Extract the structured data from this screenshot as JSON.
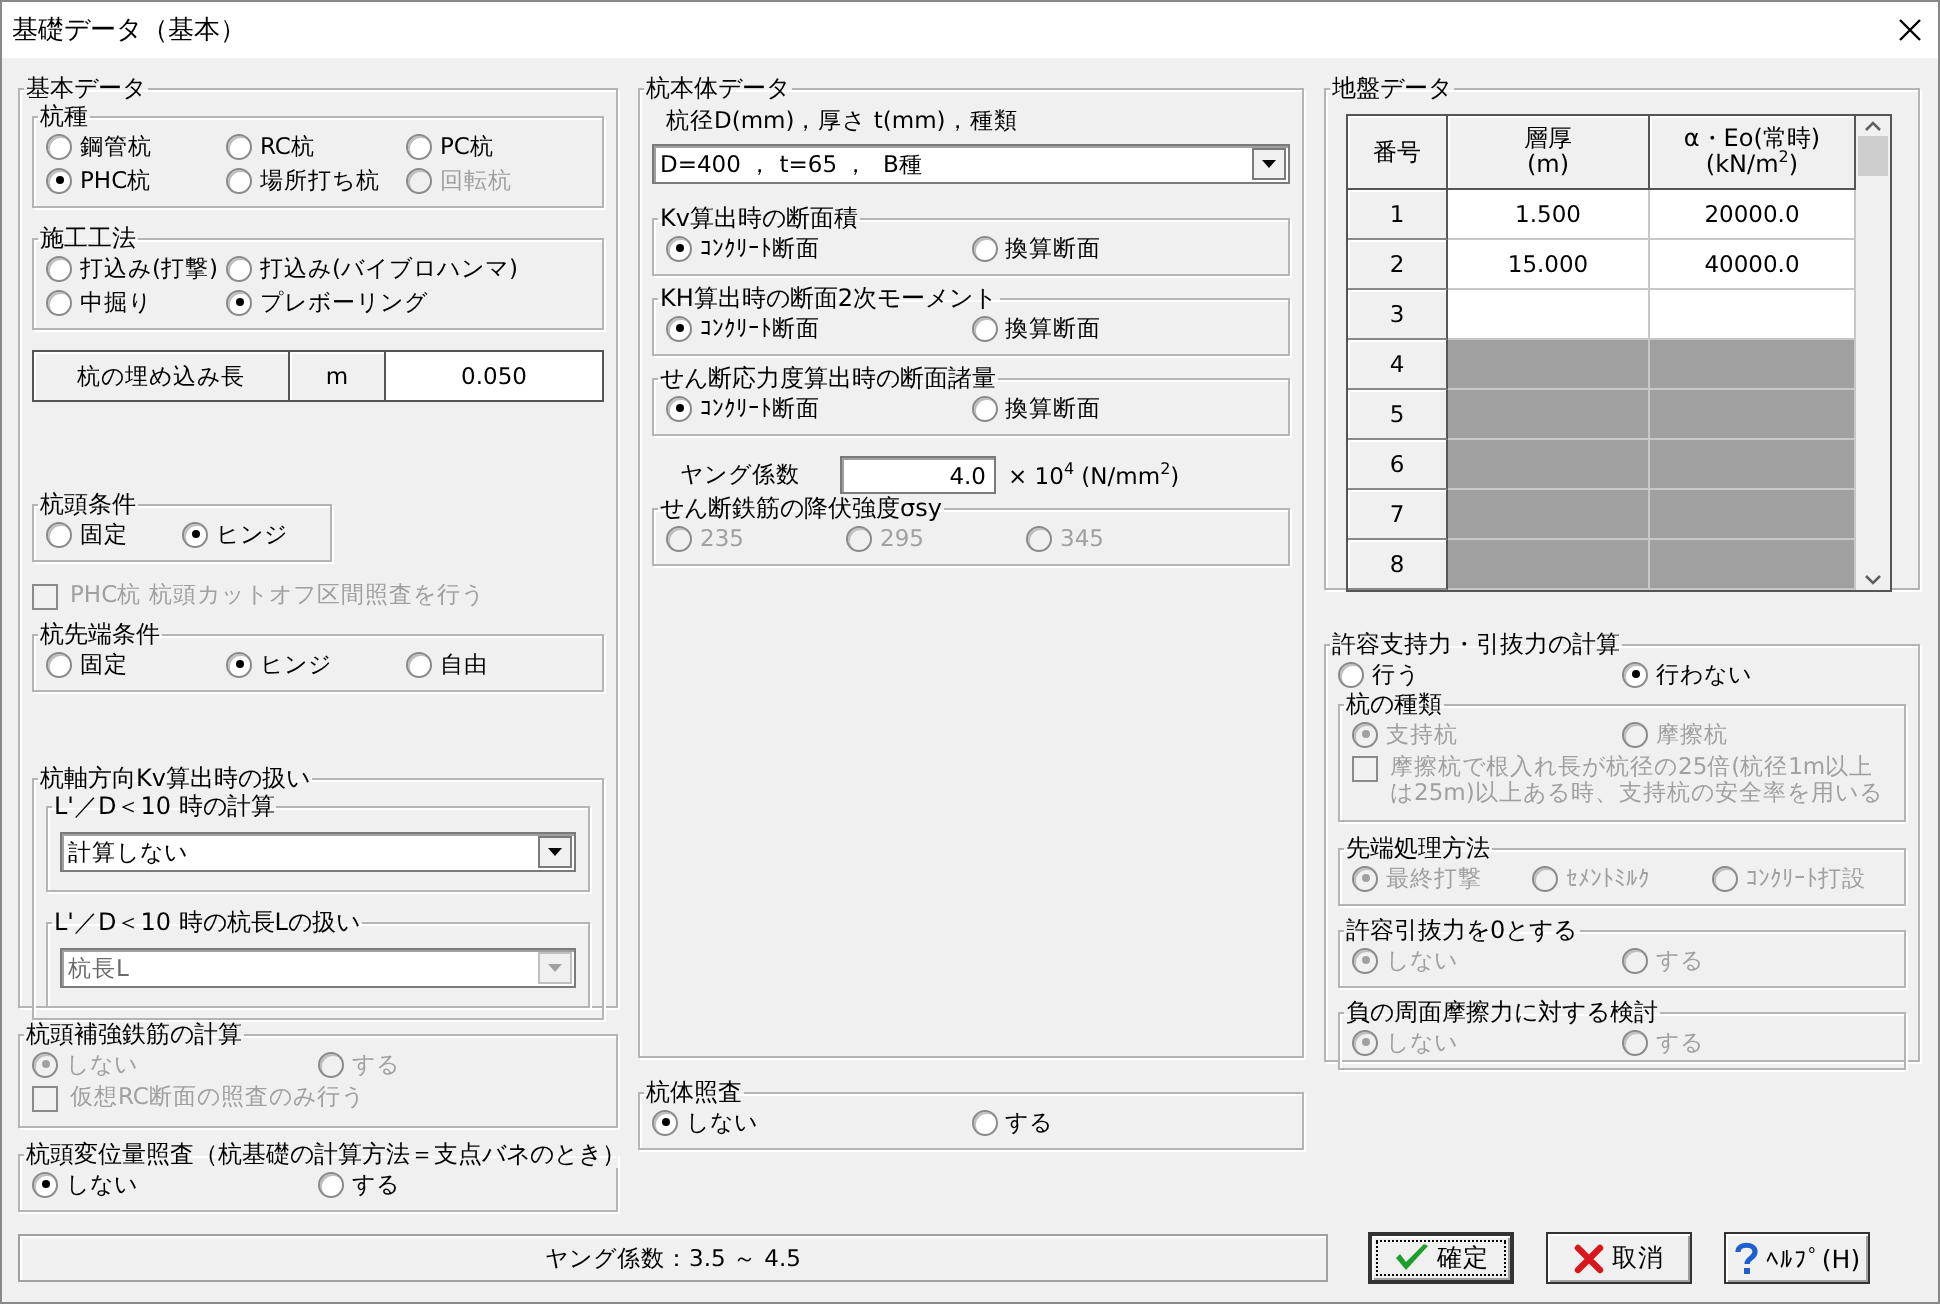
{
  "window": {
    "title": "基礎データ（基本）"
  },
  "columns": [
    {
      "blocks": [
        {
          "kind": "group",
          "title": "基本データ",
          "children": [
            {
              "kind": "group",
              "title": "杭種",
              "options": [
                {
                  "label": "鋼管杭",
                  "selected": false,
                  "disabled": false
                },
                {
                  "label": "RC杭",
                  "selected": false,
                  "disabled": false
                },
                {
                  "label": "PC杭",
                  "selected": false,
                  "disabled": false
                },
                {
                  "label": "PHC杭",
                  "selected": true,
                  "disabled": false
                },
                {
                  "label": "場所打ち杭",
                  "selected": false,
                  "disabled": false
                },
                {
                  "label": "回転杭",
                  "selected": false,
                  "disabled": true
                }
              ]
            },
            {
              "kind": "group",
              "title": "施工工法",
              "options": [
                {
                  "label": "打込み(打撃)",
                  "selected": false,
                  "disabled": false
                },
                {
                  "label": "打込み(バイブロハンマ)",
                  "selected": false,
                  "disabled": false
                },
                {
                  "label": "中掘り",
                  "selected": false,
                  "disabled": false
                },
                {
                  "label": "プレボーリング",
                  "selected": true,
                  "disabled": false
                }
              ]
            },
            {
              "kind": "value_row",
              "label": "杭の埋め込み長",
              "unit": "m",
              "value": "0.050"
            },
            {
              "kind": "group",
              "title": "杭頭条件",
              "options": [
                {
                  "label": "固定",
                  "selected": false,
                  "disabled": false
                },
                {
                  "label": "ヒンジ",
                  "selected": true,
                  "disabled": false
                }
              ]
            },
            {
              "kind": "checkbox",
              "label": "PHC杭 杭頭カットオフ区間照査を行う",
              "checked": false,
              "disabled": true
            },
            {
              "kind": "group",
              "title": "杭先端条件",
              "options": [
                {
                  "label": "固定",
                  "selected": false,
                  "disabled": false
                },
                {
                  "label": "ヒンジ",
                  "selected": true,
                  "disabled": false
                },
                {
                  "label": "自由",
                  "selected": false,
                  "disabled": false
                }
              ]
            },
            {
              "kind": "group",
              "title": "杭軸方向Kv算出時の扱い",
              "children": [
                {
                  "kind": "group",
                  "title": "L'／D＜10 時の計算",
                  "children": [
                    {
                      "kind": "dropdown",
                      "value": "計算しない",
                      "disabled": false
                    }
                  ]
                },
                {
                  "kind": "group",
                  "title": "L'／D＜10 時の杭長Lの扱い",
                  "children": [
                    {
                      "kind": "dropdown",
                      "value": "杭長L",
                      "disabled": true
                    }
                  ]
                }
              ]
            }
          ]
        },
        {
          "kind": "group",
          "title": "杭頭補強鉄筋の計算",
          "options": [
            {
              "label": "しない",
              "selected": true,
              "disabled": true
            },
            {
              "label": "する",
              "selected": false,
              "disabled": true
            }
          ],
          "children": [
            {
              "kind": "checkbox",
              "label": "仮想RC断面の照査のみ行う",
              "checked": false,
              "disabled": true
            }
          ]
        },
        {
          "kind": "group",
          "title": "杭頭変位量照査（杭基礎の計算方法＝支点バネのとき）",
          "options": [
            {
              "label": "しない",
              "selected": true,
              "disabled": false
            },
            {
              "label": "する",
              "selected": false,
              "disabled": false
            }
          ]
        }
      ]
    },
    {
      "blocks": [
        {
          "kind": "group",
          "title": "杭本体データ",
          "children": [
            {
              "kind": "label",
              "text": "杭径D(mm)，厚さ t(mm)，種類"
            },
            {
              "kind": "dropdown",
              "value": "D=400 ， t=65 ，  B種",
              "disabled": false
            },
            {
              "kind": "group",
              "title": "Kv算出時の断面積",
              "options": [
                {
                  "label": "ｺﾝｸﾘｰﾄ断面",
                  "selected": true,
                  "disabled": false
                },
                {
                  "label": "換算断面",
                  "selected": false,
                  "disabled": false
                }
              ]
            },
            {
              "kind": "group",
              "title": "KH算出時の断面2次モーメント",
              "options": [
                {
                  "label": "ｺﾝｸﾘｰﾄ断面",
                  "selected": true,
                  "disabled": false
                },
                {
                  "label": "換算断面",
                  "selected": false,
                  "disabled": false
                }
              ]
            },
            {
              "kind": "group",
              "title": "せん断応力度算出時の断面諸量",
              "options": [
                {
                  "label": "ｺﾝｸﾘｰﾄ断面",
                  "selected": true,
                  "disabled": false
                },
                {
                  "label": "換算断面",
                  "selected": false,
                  "disabled": false
                }
              ]
            },
            {
              "kind": "number_row",
              "label": "ヤング係数",
              "value": "4.0",
              "unit": "× 10$^{4}$ (N/mm$^{2}$)"
            },
            {
              "kind": "group",
              "title": "せん断鉄筋の降伏強度σsy",
              "options": [
                {
                  "label": "235",
                  "selected": false,
                  "disabled": true
                },
                {
                  "label": "295",
                  "selected": false,
                  "disabled": true
                },
                {
                  "label": "345",
                  "selected": false,
                  "disabled": true
                }
              ]
            }
          ]
        },
        {
          "kind": "group",
          "title": "杭体照査",
          "options": [
            {
              "label": "しない",
              "selected": true,
              "disabled": false
            },
            {
              "label": "する",
              "selected": false,
              "disabled": false
            }
          ]
        }
      ]
    },
    {
      "blocks": [
        {
          "kind": "group",
          "title": "地盤データ",
          "children": [
            {
              "kind": "table",
              "columns": [
                "番号",
                "層厚\n(m)",
                "α・Eo(常時)\n(kN/m$^{2}$)"
              ],
              "rows": [
                {
                  "cells": [
                    "1",
                    "1.500",
                    "20000.0"
                  ],
                  "disabled": false
                },
                {
                  "cells": [
                    "2",
                    "15.000",
                    "40000.0"
                  ],
                  "disabled": false
                },
                {
                  "cells": [
                    "3"
                  ],
                  "disabled": false
                },
                {
                  "cells": [
                    "4"
                  ],
                  "disabled": true
                },
                {
                  "cells": [
                    "5"
                  ],
                  "disabled": true
                },
                {
                  "cells": [
                    "6"
                  ],
                  "disabled": true
                },
                {
                  "cells": [
                    "7"
                  ],
                  "disabled": true
                },
                {
                  "cells": [
                    "8"
                  ],
                  "disabled": true
                }
              ]
            }
          ]
        },
        {
          "kind": "group",
          "title": "許容支持力・引抜力の計算",
          "options": [
            {
              "label": "行う",
              "selected": false,
              "disabled": false
            },
            {
              "label": "行わない",
              "selected": true,
              "disabled": false
            }
          ],
          "children": [
            {
              "kind": "group",
              "title": "杭の種類",
              "options": [
                {
                  "label": "支持杭",
                  "selected": true,
                  "disabled": true
                },
                {
                  "label": "摩擦杭",
                  "selected": false,
                  "disabled": true
                }
              ],
              "children": [
                {
                  "kind": "checkbox",
                  "label": "摩擦杭で根入れ長が杭径の25倍(杭径1m以上は25m)以上ある時、支持杭の安全率を用いる",
                  "checked": false,
                  "disabled": true
                }
              ]
            },
            {
              "kind": "group",
              "title": "先端処理方法",
              "options": [
                {
                  "label": "最終打撃",
                  "selected": true,
                  "disabled": true
                },
                {
                  "label": "ｾﾒﾝﾄﾐﾙｸ",
                  "selected": false,
                  "disabled": true
                },
                {
                  "label": "ｺﾝｸﾘｰﾄ打設",
                  "selected": false,
                  "disabled": true
                }
              ]
            },
            {
              "kind": "group",
              "title": "許容引抜力を0とする",
              "options": [
                {
                  "label": "しない",
                  "selected": true,
                  "disabled": true
                },
                {
                  "label": "する",
                  "selected": false,
                  "disabled": true
                }
              ]
            },
            {
              "kind": "group",
              "title": "負の周面摩擦力に対する検討",
              "options": [
                {
                  "label": "しない",
                  "selected": true,
                  "disabled": true
                },
                {
                  "label": "する",
                  "selected": false,
                  "disabled": true
                }
              ]
            }
          ]
        }
      ]
    }
  ],
  "status_bar": {
    "text": "ヤング係数：3.5 ～ 4.5"
  },
  "buttons": [
    {
      "label": "確定",
      "kind": "ok",
      "focused": true
    },
    {
      "label": "取消",
      "kind": "cancel",
      "focused": false
    },
    {
      "label": "ﾍﾙﾌﾟ(H)",
      "kind": "help",
      "focused": false
    }
  ]
}
